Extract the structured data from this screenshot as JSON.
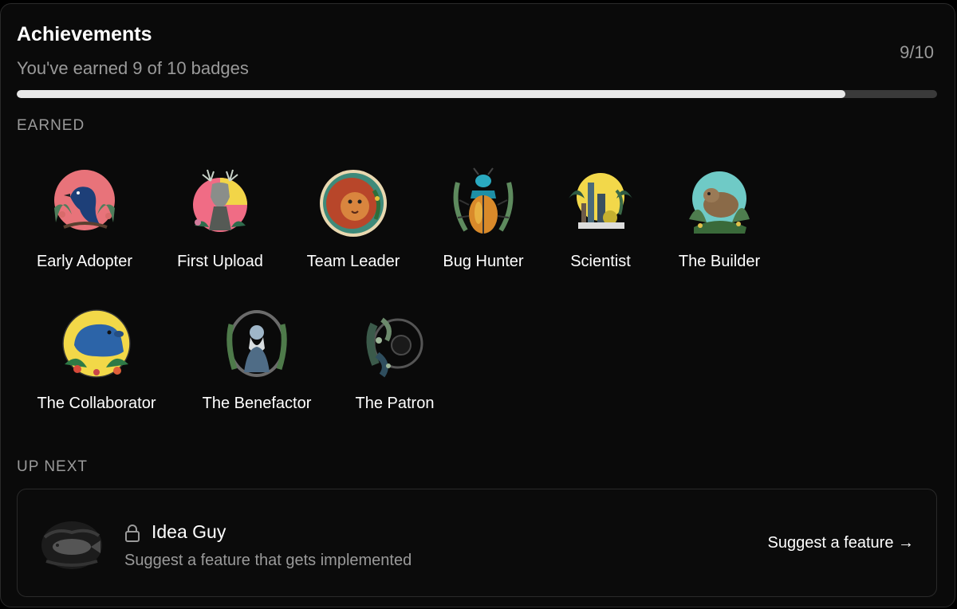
{
  "header": {
    "title": "Achievements",
    "subtitle": "You've earned 9 of 10 badges",
    "count": "9/10",
    "progress": 0.9
  },
  "sections": {
    "earned_label": "EARNED",
    "next_label": "UP NEXT"
  },
  "badges": [
    {
      "label": "Early Adopter",
      "icon": "crow-icon"
    },
    {
      "label": "First Upload",
      "icon": "stag-icon"
    },
    {
      "label": "Team Leader",
      "icon": "lion-icon"
    },
    {
      "label": "Bug Hunter",
      "icon": "beetle-icon"
    },
    {
      "label": "Scientist",
      "icon": "lab-flasks-icon"
    },
    {
      "label": "The Builder",
      "icon": "beaver-icon"
    },
    {
      "label": "The Collaborator",
      "icon": "capybara-icon"
    },
    {
      "label": "The Benefactor",
      "icon": "bearded-man-portrait-icon"
    },
    {
      "label": "The Patron",
      "icon": "foliage-wreath-icon"
    }
  ],
  "next": {
    "name": "Idea Guy",
    "description": "Suggest a feature that gets implemented",
    "action": "Suggest a feature →",
    "icon": "fish-icon",
    "lock_icon": "lock-icon"
  },
  "colors": {
    "background": "#0a0a0a",
    "progress_fill": "#e8e8e8",
    "progress_track": "#3a3a3a",
    "muted_text": "#9a9a9a"
  }
}
